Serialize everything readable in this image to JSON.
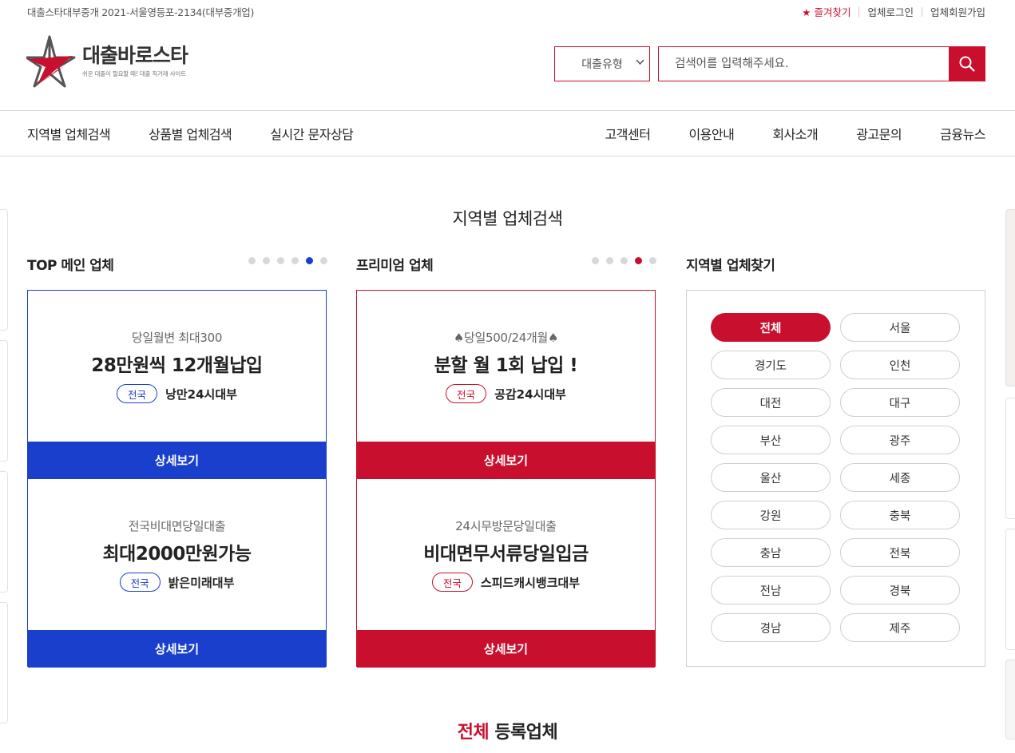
{
  "topbar": {
    "license": "대출스타대부중개 2021-서울영등포-2134(대부중개업)",
    "favorite": "★ 즐겨찾기",
    "login": "업체로그인",
    "signup": "업체회원가입"
  },
  "header": {
    "logo_name": "대출바로스타",
    "logo_tagline": "쉬운 대출이 필요할 때! 대출 직거래 사이트",
    "select_value": "대출유형",
    "search_placeholder": "검색어를 입력해주세요.",
    "icons": {
      "search": "search-icon",
      "chevron": "chevron-down-icon",
      "logo": "star-logo-icon"
    },
    "accent_color": "#c8102e"
  },
  "nav": {
    "left": [
      "지역별 업체검색",
      "상품별 업체검색",
      "실시간 문자상담"
    ],
    "right": [
      "고객센터",
      "이용안내",
      "회사소개",
      "광고문의",
      "금융뉴스"
    ]
  },
  "section_title": "지역별 업체검색",
  "top_main": {
    "title": "TOP 메인 업체",
    "color": "#1a3fcc",
    "active_dot": 5,
    "dot_count": 6,
    "cards": [
      {
        "sub": "당일월변 최대300",
        "headline": "28만원씩 12개월납입",
        "badge": "전국",
        "company": "낭만24시대부",
        "button": "상세보기"
      },
      {
        "sub": "전국비대면당일대출",
        "headline": "최대2000만원가능",
        "badge": "전국",
        "company": "밝은미래대부",
        "button": "상세보기"
      }
    ]
  },
  "premium": {
    "title": "프리미엄 업체",
    "color": "#c8102e",
    "active_dot": 4,
    "dot_count": 5,
    "cards": [
      {
        "sub": "♠당일500/24개월♠",
        "headline": "분할 월 1회 납입 !",
        "badge": "전국",
        "company": "공감24시대부",
        "button": "상세보기"
      },
      {
        "sub": "24시무방문당일대출",
        "headline": "비대면무서류당일입금",
        "badge": "전국",
        "company": "스피드캐시뱅크대부",
        "button": "상세보기"
      }
    ]
  },
  "region": {
    "title": "지역별 업체찾기",
    "active": "전체",
    "items": [
      "전체",
      "서울",
      "경기도",
      "인천",
      "대전",
      "대구",
      "부산",
      "광주",
      "울산",
      "세종",
      "강원",
      "충북",
      "충남",
      "전북",
      "전남",
      "경북",
      "경남",
      "제주"
    ]
  },
  "bottom_title": {
    "highlight": "전체",
    "rest": " 등록업체"
  }
}
